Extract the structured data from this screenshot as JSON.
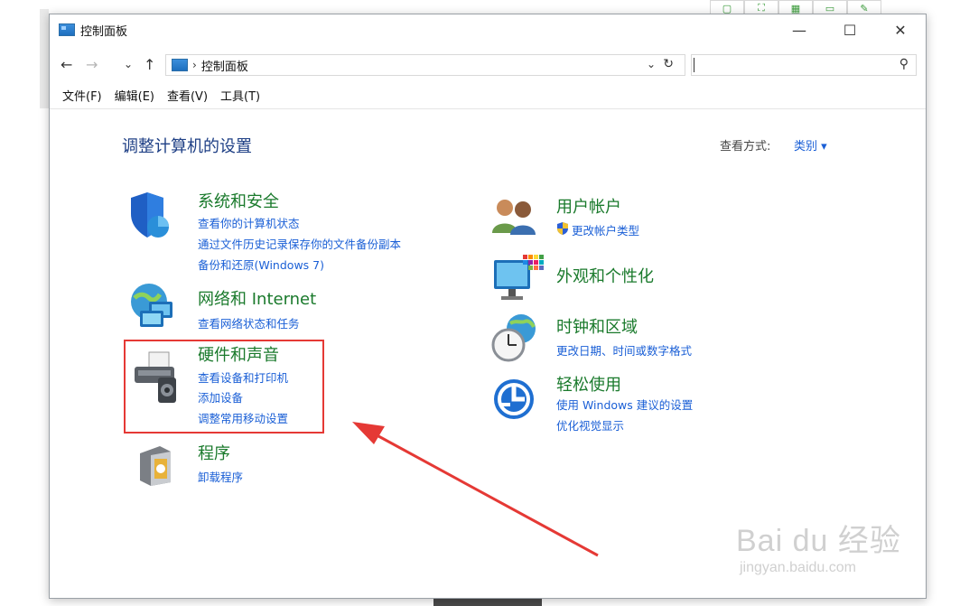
{
  "window": {
    "title": "控制面板",
    "controls": {
      "minimize": "—",
      "maximize": "☐",
      "close": "✕"
    }
  },
  "nav": {
    "back": "←",
    "forward": "→",
    "recent": "⌄",
    "up": "↑"
  },
  "address": {
    "separator": "›",
    "path": "控制面板",
    "dropdown": "⌄",
    "refresh": "↻"
  },
  "search": {
    "placeholder": "",
    "icon": "⚲"
  },
  "menu": [
    "文件(F)",
    "编辑(E)",
    "查看(V)",
    "工具(T)"
  ],
  "content": {
    "title": "调整计算机的设置",
    "view_by_label": "查看方式:",
    "view_by_value": "类别 ▾"
  },
  "categories": {
    "system": {
      "title": "系统和安全",
      "links": [
        "查看你的计算机状态",
        "通过文件历史记录保存你的文件备份副本",
        "备份和还原(Windows 7)"
      ]
    },
    "network": {
      "title": "网络和 Internet",
      "links": [
        "查看网络状态和任务"
      ]
    },
    "hardware": {
      "title": "硬件和声音",
      "links": [
        "查看设备和打印机",
        "添加设备",
        "调整常用移动设置"
      ]
    },
    "programs": {
      "title": "程序",
      "links": [
        "卸载程序"
      ]
    },
    "user": {
      "title": "用户帐户",
      "links": [
        "更改帐户类型"
      ]
    },
    "appearance": {
      "title": "外观和个性化",
      "links": []
    },
    "clock": {
      "title": "时钟和区域",
      "links": [
        "更改日期、时间或数字格式"
      ]
    },
    "ease": {
      "title": "轻松使用",
      "links": [
        "使用 Windows 建议的设置",
        "优化视觉显示"
      ]
    }
  },
  "watermark": {
    "main": "Bai du 经验",
    "sub": "jingyan.baidu.com"
  },
  "colors": {
    "category_title": "#1a7a2c",
    "link": "#1a5fd6",
    "heading": "#1e3f85",
    "highlight": "#e53935",
    "arrow": "#e53935"
  }
}
